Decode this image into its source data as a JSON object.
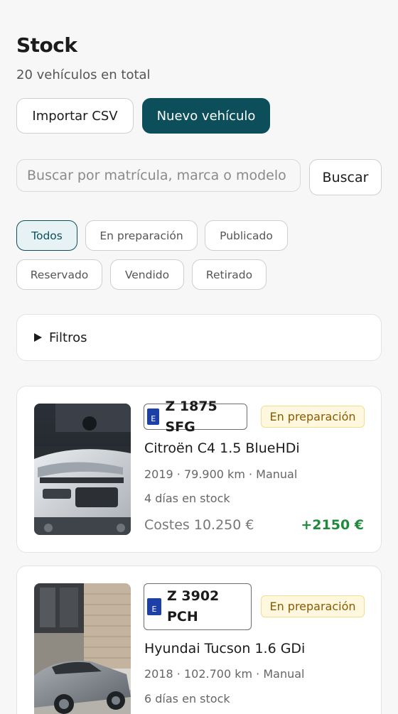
{
  "header": {
    "title": "Stock",
    "subtitle": "20 vehículos en total"
  },
  "actions": {
    "import_label": "Importar CSV",
    "new_label": "Nuevo vehículo"
  },
  "search": {
    "placeholder": "Buscar por matrícula, marca o modelo",
    "value": "",
    "button_label": "Buscar"
  },
  "status_filters": [
    {
      "label": "Todos",
      "active": true
    },
    {
      "label": "En preparación",
      "active": false
    },
    {
      "label": "Publicado",
      "active": false
    },
    {
      "label": "Reservado",
      "active": false
    },
    {
      "label": "Vendido",
      "active": false
    },
    {
      "label": "Retirado",
      "active": false
    }
  ],
  "filters_panel": {
    "label": "Filtros",
    "icon": "triangle-right-icon"
  },
  "vehicles": [
    {
      "plate_country": "E",
      "plate": "Z 1875 SFG",
      "status": "En preparación",
      "model": "Citroën C4 1.5 BlueHDi",
      "meta": "2019 · 79.900 km · Manual",
      "days": "4 días en stock",
      "costs": "Costes 10.250 €",
      "margin": "+2150 €",
      "photo": "white-citroen-suv-photo"
    },
    {
      "plate_country": "E",
      "plate": "Z 3902 PCH",
      "status": "En preparación",
      "model": "Hyundai Tucson 1.6 GDi",
      "meta": "2018 · 102.700 km · Manual",
      "days": "6 días en stock",
      "photo": "grey-hyundai-suv-photo"
    }
  ],
  "colors": {
    "primary": "#0c4f5b",
    "status_bg": "#fff8de",
    "status_text": "#8a5a00",
    "margin_positive": "#1e8a3a"
  }
}
